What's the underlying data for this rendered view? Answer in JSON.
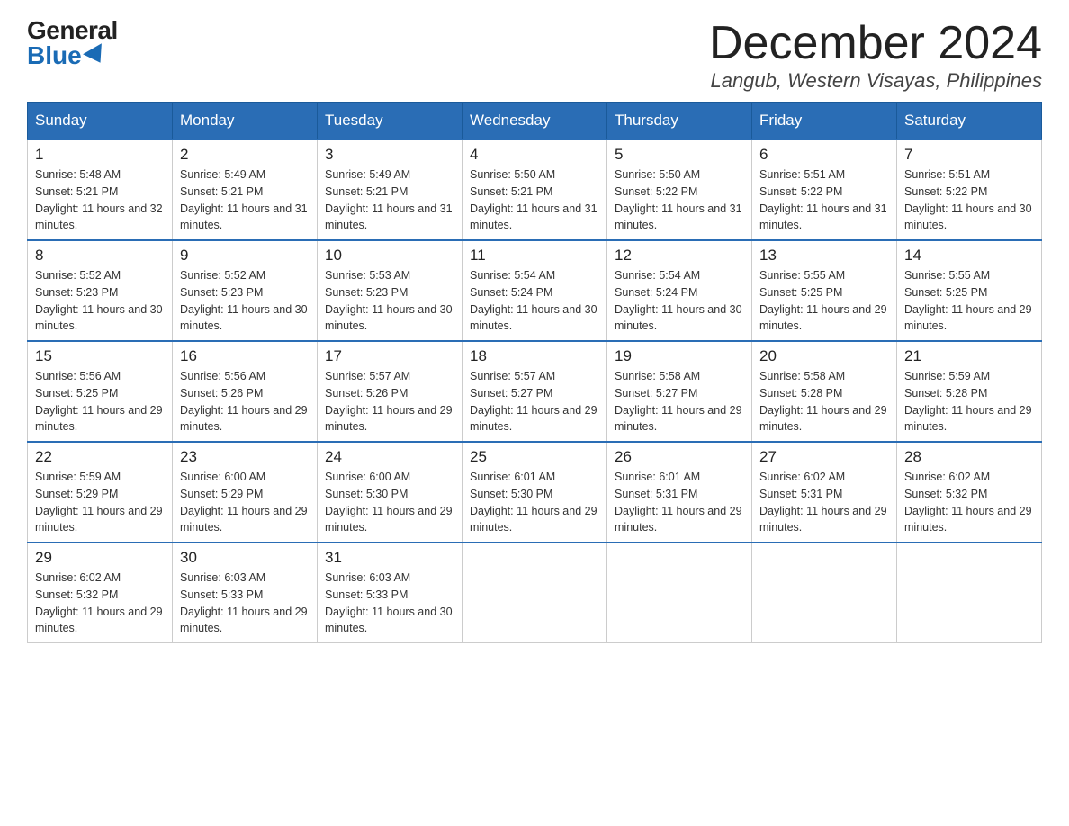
{
  "header": {
    "logo_general": "General",
    "logo_blue": "Blue",
    "month_title": "December 2024",
    "location": "Langub, Western Visayas, Philippines"
  },
  "weekdays": [
    "Sunday",
    "Monday",
    "Tuesday",
    "Wednesday",
    "Thursday",
    "Friday",
    "Saturday"
  ],
  "weeks": [
    [
      {
        "day": "1",
        "sunrise": "5:48 AM",
        "sunset": "5:21 PM",
        "daylight": "11 hours and 32 minutes."
      },
      {
        "day": "2",
        "sunrise": "5:49 AM",
        "sunset": "5:21 PM",
        "daylight": "11 hours and 31 minutes."
      },
      {
        "day": "3",
        "sunrise": "5:49 AM",
        "sunset": "5:21 PM",
        "daylight": "11 hours and 31 minutes."
      },
      {
        "day": "4",
        "sunrise": "5:50 AM",
        "sunset": "5:21 PM",
        "daylight": "11 hours and 31 minutes."
      },
      {
        "day": "5",
        "sunrise": "5:50 AM",
        "sunset": "5:22 PM",
        "daylight": "11 hours and 31 minutes."
      },
      {
        "day": "6",
        "sunrise": "5:51 AM",
        "sunset": "5:22 PM",
        "daylight": "11 hours and 31 minutes."
      },
      {
        "day": "7",
        "sunrise": "5:51 AM",
        "sunset": "5:22 PM",
        "daylight": "11 hours and 30 minutes."
      }
    ],
    [
      {
        "day": "8",
        "sunrise": "5:52 AM",
        "sunset": "5:23 PM",
        "daylight": "11 hours and 30 minutes."
      },
      {
        "day": "9",
        "sunrise": "5:52 AM",
        "sunset": "5:23 PM",
        "daylight": "11 hours and 30 minutes."
      },
      {
        "day": "10",
        "sunrise": "5:53 AM",
        "sunset": "5:23 PM",
        "daylight": "11 hours and 30 minutes."
      },
      {
        "day": "11",
        "sunrise": "5:54 AM",
        "sunset": "5:24 PM",
        "daylight": "11 hours and 30 minutes."
      },
      {
        "day": "12",
        "sunrise": "5:54 AM",
        "sunset": "5:24 PM",
        "daylight": "11 hours and 30 minutes."
      },
      {
        "day": "13",
        "sunrise": "5:55 AM",
        "sunset": "5:25 PM",
        "daylight": "11 hours and 29 minutes."
      },
      {
        "day": "14",
        "sunrise": "5:55 AM",
        "sunset": "5:25 PM",
        "daylight": "11 hours and 29 minutes."
      }
    ],
    [
      {
        "day": "15",
        "sunrise": "5:56 AM",
        "sunset": "5:25 PM",
        "daylight": "11 hours and 29 minutes."
      },
      {
        "day": "16",
        "sunrise": "5:56 AM",
        "sunset": "5:26 PM",
        "daylight": "11 hours and 29 minutes."
      },
      {
        "day": "17",
        "sunrise": "5:57 AM",
        "sunset": "5:26 PM",
        "daylight": "11 hours and 29 minutes."
      },
      {
        "day": "18",
        "sunrise": "5:57 AM",
        "sunset": "5:27 PM",
        "daylight": "11 hours and 29 minutes."
      },
      {
        "day": "19",
        "sunrise": "5:58 AM",
        "sunset": "5:27 PM",
        "daylight": "11 hours and 29 minutes."
      },
      {
        "day": "20",
        "sunrise": "5:58 AM",
        "sunset": "5:28 PM",
        "daylight": "11 hours and 29 minutes."
      },
      {
        "day": "21",
        "sunrise": "5:59 AM",
        "sunset": "5:28 PM",
        "daylight": "11 hours and 29 minutes."
      }
    ],
    [
      {
        "day": "22",
        "sunrise": "5:59 AM",
        "sunset": "5:29 PM",
        "daylight": "11 hours and 29 minutes."
      },
      {
        "day": "23",
        "sunrise": "6:00 AM",
        "sunset": "5:29 PM",
        "daylight": "11 hours and 29 minutes."
      },
      {
        "day": "24",
        "sunrise": "6:00 AM",
        "sunset": "5:30 PM",
        "daylight": "11 hours and 29 minutes."
      },
      {
        "day": "25",
        "sunrise": "6:01 AM",
        "sunset": "5:30 PM",
        "daylight": "11 hours and 29 minutes."
      },
      {
        "day": "26",
        "sunrise": "6:01 AM",
        "sunset": "5:31 PM",
        "daylight": "11 hours and 29 minutes."
      },
      {
        "day": "27",
        "sunrise": "6:02 AM",
        "sunset": "5:31 PM",
        "daylight": "11 hours and 29 minutes."
      },
      {
        "day": "28",
        "sunrise": "6:02 AM",
        "sunset": "5:32 PM",
        "daylight": "11 hours and 29 minutes."
      }
    ],
    [
      {
        "day": "29",
        "sunrise": "6:02 AM",
        "sunset": "5:32 PM",
        "daylight": "11 hours and 29 minutes."
      },
      {
        "day": "30",
        "sunrise": "6:03 AM",
        "sunset": "5:33 PM",
        "daylight": "11 hours and 29 minutes."
      },
      {
        "day": "31",
        "sunrise": "6:03 AM",
        "sunset": "5:33 PM",
        "daylight": "11 hours and 30 minutes."
      },
      null,
      null,
      null,
      null
    ]
  ],
  "labels": {
    "sunrise_prefix": "Sunrise: ",
    "sunset_prefix": "Sunset: ",
    "daylight_prefix": "Daylight: "
  }
}
